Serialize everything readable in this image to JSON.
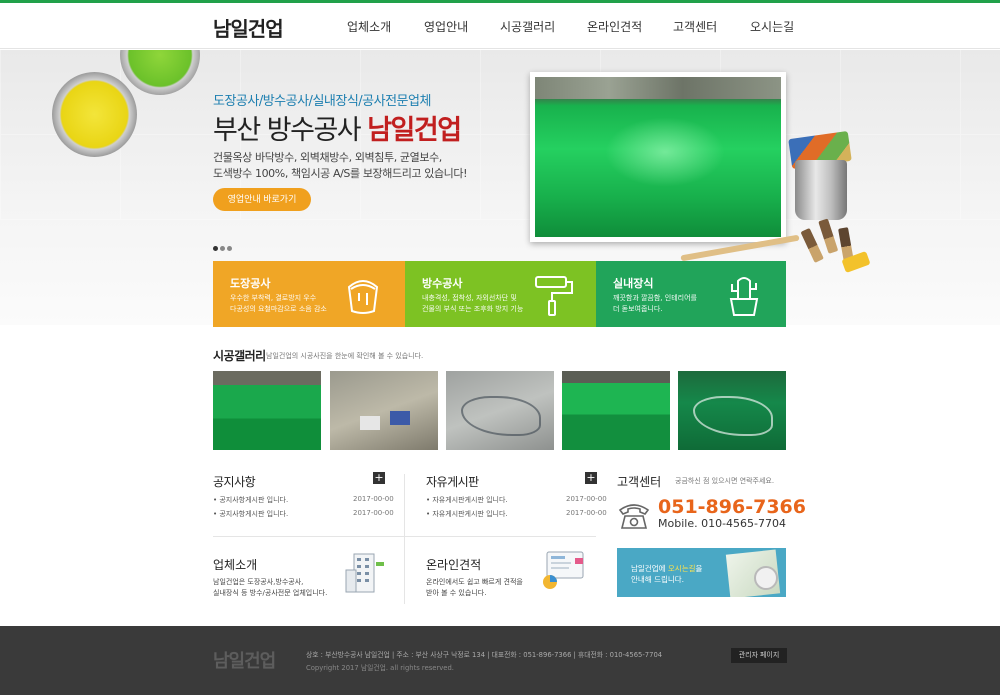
{
  "header": {
    "logo": "남일건업",
    "nav": [
      "업체소개",
      "영업안내",
      "시공갤러리",
      "온라인견적",
      "고객센터",
      "오시는길"
    ]
  },
  "hero": {
    "subtitle": "도장공사/방수공사/실내장식/공사전문업체",
    "title_prefix": "부산 방수공사",
    "title_brand": "남일건업",
    "desc_line1": "건물옥상 바닥방수, 외벽채방수, 외벽침투, 균열보수,",
    "desc_line2": "도색방수 100%, 책임시공 A/S를 보장해드리고 있습니다!",
    "button": "영업안내 바로가기"
  },
  "services": [
    {
      "title": "도장공사",
      "desc1": "우수한 부착력, 결로방지 우수",
      "desc2": "다공성의 요철마감으로 소음 감소",
      "color": "#f0a626"
    },
    {
      "title": "방수공사",
      "desc1": "내충격성, 접착성, 자외선차단 및",
      "desc2": "건물의 부식 또는 조후화 방지 기능",
      "color": "#7dc223"
    },
    {
      "title": "실내장식",
      "desc1": "깨끗함과 깔끔함, 인테리어를",
      "desc2": "더 돋보여줍니다.",
      "color": "#21a45a"
    }
  ],
  "gallery": {
    "title": "시공갤러리",
    "sub": "남일건업의 시공사진을 한눈에 확인해 볼 수 있습니다."
  },
  "notice": {
    "title": "공지사항",
    "plus": "+",
    "rows": [
      {
        "text": "공지사항게시판 입니다.",
        "date": "2017-00-00"
      },
      {
        "text": "공지사항게시판 입니다.",
        "date": "2017-00-00"
      }
    ]
  },
  "free_board": {
    "title": "자유게시판",
    "plus": "+",
    "rows": [
      {
        "text": "자유게시판게시판 입니다.",
        "date": "2017-00-00"
      },
      {
        "text": "자유게시판게시판 입니다.",
        "date": "2017-00-00"
      }
    ]
  },
  "customer": {
    "title": "고객센터",
    "sub": "궁금하신 점 있으시면 연락주세요.",
    "tel": "051-896-7366",
    "mobile": "Mobile. 010-4565-7704"
  },
  "company": {
    "title": "업체소개",
    "desc1": "남일건업은 도장공사,방수공사,",
    "desc2": "실내장식 등 방수/공사전문 업체입니다."
  },
  "estimate": {
    "title": "온라인견적",
    "desc1": "온라인에서도 쉽고 빠르게 견적을",
    "desc2": "받아 볼 수 있습니다."
  },
  "map_banner": {
    "line1_prefix": "남일건업에 ",
    "line1_highlight": "오시는길",
    "line1_suffix": "을",
    "line2": "안내해 드립니다."
  },
  "footer": {
    "logo": "남일건업",
    "info": "상호 : 부산방수공사 남일건업  |  주소 : 부산 사상구 낙정로 134  |  대표전화 : 051-896-7366  |  휴대전화 : 010-4565-7704",
    "copy": "Copyright 2017 남일건업. all rights reserved.",
    "admin": "관리자 페이지"
  }
}
